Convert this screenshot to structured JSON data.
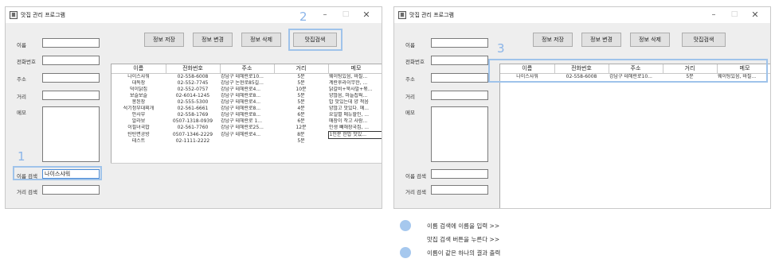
{
  "window": {
    "title": "맛집 관리 프로그램",
    "min_glyph": "–",
    "max_glyph": "□",
    "close_glyph": "✕"
  },
  "form": {
    "name_label": "이름",
    "phone_label": "전화번호",
    "address_label": "주소",
    "distance_label": "거리",
    "memo_label": "메모",
    "name_search_label": "이름 검색",
    "distance_search_label": "거리 검색",
    "name_search_value": "나이스샤워"
  },
  "buttons": {
    "save": "정보 저장",
    "edit": "정보 변경",
    "delete": "정보 삭제",
    "search": "맛집검색"
  },
  "table": {
    "columns": [
      "이름",
      "전화번호",
      "주소",
      "거리",
      "메모"
    ],
    "rows": [
      [
        "나이스샤워",
        "02-558-6008",
        "강남구 테헤란로10...",
        "5분",
        "웨이팅있음, 바질..."
      ],
      [
        "대독장",
        "02-552-7745",
        "강남구 논현로85길...",
        "5분",
        "계란후라이무한, ..."
      ],
      [
        "덕이닭집",
        "02-552-0757",
        "강남구 테헤란로4...",
        "10분",
        "닭갈비+묵사발+볶..."
      ],
      [
        "보슬보슬",
        "02-6014-1245",
        "강남구 테헤란로8...",
        "5분",
        "양많음, 마늘칩뭑..."
      ],
      [
        "봉된장",
        "02-555-5300",
        "강남구 테헤란로4...",
        "5분",
        "밥 맛있는데 양 적음"
      ],
      [
        "석기정부대찌개",
        "02-561-6661",
        "강남구 테헤란로8...",
        "4분",
        "양많고 맛있다. 메..."
      ],
      [
        "안사부",
        "02-558-1769",
        "강남구 테헤란로8...",
        "6분",
        "요일별 메뉴할인, ..."
      ],
      [
        "알라보",
        "0507-1318-0939",
        "강남구 테헤란로 1...",
        "6분",
        "매장이 작고 사람..."
      ],
      [
        "이필녀국밥",
        "02-561-7760",
        "강남구 테헤란로25...",
        "12분",
        "인생 빼해장국집, ..."
      ],
      [
        "탄탄면공방",
        "0507-1346-2229",
        "강남구 테헤란로4...",
        "8분",
        "1인분 한밥 맛있..."
      ],
      [
        "테스트",
        "02-1111-2222",
        "",
        "5분",
        ""
      ]
    ],
    "result_rows": [
      [
        "나이스샤워",
        "02-558-6008",
        "강남구 테헤란로10...",
        "5분",
        "웨이팅있음, 바질..."
      ]
    ]
  },
  "annotations": {
    "step1": "1",
    "step2": "2",
    "step3": "3",
    "accent": "#8ab4e8"
  },
  "legend": {
    "line1": "이름 검색에 이름을 입력 >>",
    "line2": "맛집 검색 버튼을 누른다 >>",
    "line3": "이름이 같은 하나의 결과 출력"
  }
}
